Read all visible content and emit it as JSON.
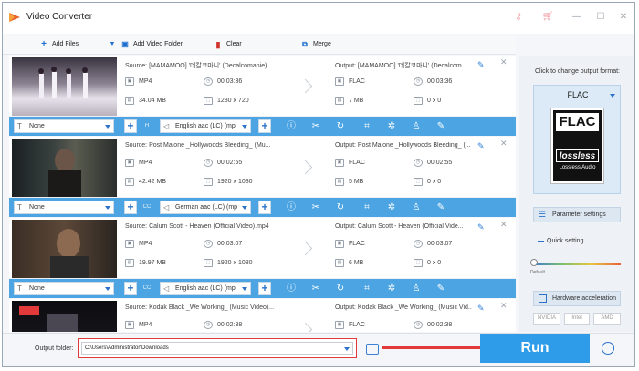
{
  "app": {
    "title": "Video Converter"
  },
  "window": {
    "icons": [
      "key-icon",
      "cart-icon",
      "minimize-icon",
      "maximize-icon",
      "close-icon"
    ]
  },
  "toolbar": {
    "add_files": "Add Files",
    "add_video_folder": "Add Video Folder",
    "clear": "Clear",
    "merge": "Merge"
  },
  "items": [
    {
      "source": "Source: [MAMAMOO] '데칼코마니' (Decalcomanie) ...",
      "src_format": "MP4",
      "src_duration": "00:03:36",
      "src_size": "34.04 MB",
      "src_res": "1280 x 720",
      "output": "Output: [MAMAMOO] '데칼코마니' (Decalcom...",
      "out_format": "FLAC",
      "out_duration": "00:03:36",
      "out_size": "7 MB",
      "out_res": "0 x 0",
      "subtitle": "None",
      "audio": "English aac (LC) (mp"
    },
    {
      "source": "Source: Post Malone _Hollywoods Bleeding_ (Mu...",
      "src_format": "MP4",
      "src_duration": "00:02:55",
      "src_size": "42.42 MB",
      "src_res": "1920 x 1080",
      "output": "Output: Post Malone _Hollywoods Bleeding_ (...",
      "out_format": "FLAC",
      "out_duration": "00:02:55",
      "out_size": "5 MB",
      "out_res": "0 x 0",
      "subtitle": "None",
      "audio": "German aac (LC) (mp"
    },
    {
      "source": "Source: Calum Scott - Heaven (Official Video).mp4",
      "src_format": "MP4",
      "src_duration": "00:03:07",
      "src_size": "19.97 MB",
      "src_res": "1920 x 1080",
      "output": "Output: Calum Scott - Heaven (Official Vide...",
      "out_format": "FLAC",
      "out_duration": "00:03:07",
      "out_size": "6 MB",
      "out_res": "0 x 0",
      "subtitle": "None",
      "audio": "English aac (LC) (mp"
    },
    {
      "source": "Source: Kodak Black _We Working_ (Music Video)...",
      "src_format": "MP4",
      "src_duration": "00:02:38",
      "src_size": "",
      "src_res": "",
      "output": "Output: Kodak Black _We Working_ (Music Vid...",
      "out_format": "FLAC",
      "out_duration": "00:02:38",
      "out_size": "",
      "out_res": "",
      "subtitle": "",
      "audio": ""
    }
  ],
  "right_panel": {
    "click_to_change": "Click to change output format:",
    "format": "FLAC",
    "art_top": "FLAC",
    "art_mid": "lossless",
    "art_sub": "Lossless Audio",
    "parameter_settings": "Parameter settings",
    "quick_setting": "Quick setting",
    "default_label": "Default",
    "quick_level": 0,
    "hardware_acceleration": "Hardware acceleration",
    "chips": [
      "NVIDIA",
      "Intel",
      "AMD"
    ]
  },
  "bottom": {
    "output_folder_label": "Output folder:",
    "output_path": "C:\\Users\\Administrator\\Downloads",
    "run": "Run"
  },
  "colors": {
    "accent": "#2e9ce8",
    "bar": "#4ca4e2",
    "highlight": "#e23a3a"
  }
}
